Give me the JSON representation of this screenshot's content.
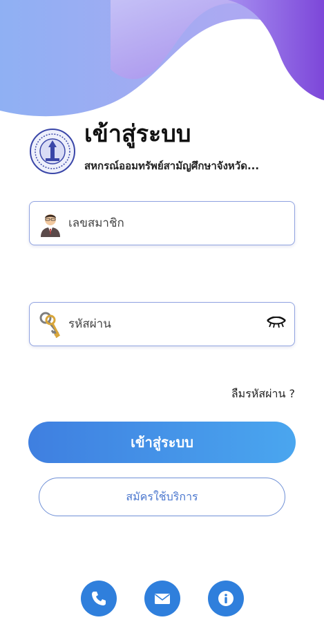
{
  "header": {
    "title": "เข้าสู่ระบบ",
    "subtitle": "สหกรณ์ออมทรัพย์สามัญศึกษาจังหวัด..."
  },
  "form": {
    "member_placeholder": "เลขสมาชิก",
    "password_placeholder": "รหัสผ่าน",
    "forgot_label": "ลืมรหัสผ่าน ?"
  },
  "buttons": {
    "login_label": "เข้าสู่ระบบ",
    "register_label": "สมัครใช้บริการ"
  },
  "footer": {
    "icons": [
      "phone-icon",
      "mail-icon",
      "info-icon"
    ]
  },
  "colors": {
    "accent": "#2f7fdc",
    "wave_light": "#a9b6f5",
    "wave_dark": "#8a56e0"
  }
}
